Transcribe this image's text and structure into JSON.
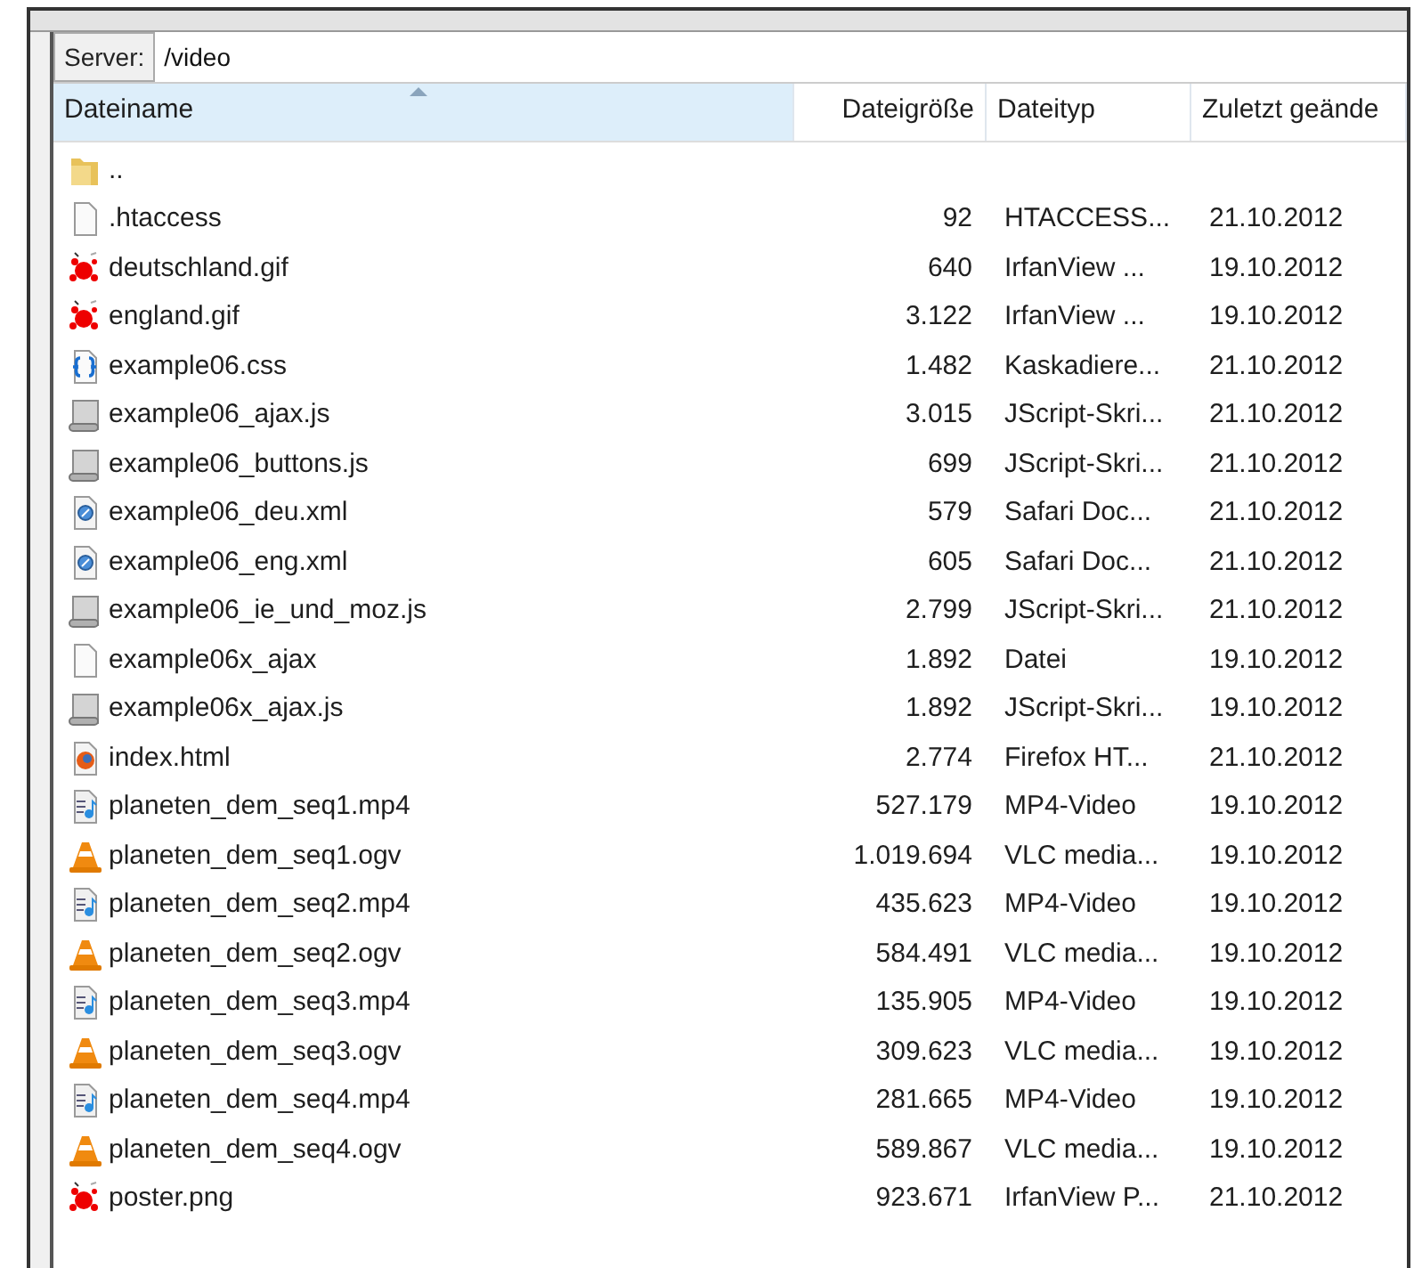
{
  "server": {
    "label": "Server:",
    "value": "/video"
  },
  "columns": [
    {
      "label": "Dateiname",
      "sorted": true
    },
    {
      "label": "Dateigröße",
      "sorted": false
    },
    {
      "label": "Dateityp",
      "sorted": false
    },
    {
      "label": "Zuletzt geände",
      "sorted": false
    }
  ],
  "files": [
    {
      "kind": "folder",
      "name": ".."
    },
    {
      "kind": "blank",
      "name": ".htaccess",
      "size": "92",
      "type": "HTACCESS...",
      "modified": "21.10.2012"
    },
    {
      "kind": "image",
      "name": "deutschland.gif",
      "size": "640",
      "type": "IrfanView ...",
      "modified": "19.10.2012"
    },
    {
      "kind": "image",
      "name": "england.gif",
      "size": "3.122",
      "type": "IrfanView ...",
      "modified": "19.10.2012"
    },
    {
      "kind": "css",
      "name": "example06.css",
      "size": "1.482",
      "type": "Kaskadiere...",
      "modified": "21.10.2012"
    },
    {
      "kind": "script",
      "name": "example06_ajax.js",
      "size": "3.015",
      "type": "JScript-Skri...",
      "modified": "21.10.2012"
    },
    {
      "kind": "script",
      "name": "example06_buttons.js",
      "size": "699",
      "type": "JScript-Skri...",
      "modified": "21.10.2012"
    },
    {
      "kind": "xml",
      "name": "example06_deu.xml",
      "size": "579",
      "type": "Safari Doc...",
      "modified": "21.10.2012"
    },
    {
      "kind": "xml",
      "name": "example06_eng.xml",
      "size": "605",
      "type": "Safari Doc...",
      "modified": "21.10.2012"
    },
    {
      "kind": "script",
      "name": "example06_ie_und_moz.js",
      "size": "2.799",
      "type": "JScript-Skri...",
      "modified": "21.10.2012"
    },
    {
      "kind": "blank",
      "name": "example06x_ajax",
      "size": "1.892",
      "type": "Datei",
      "modified": "19.10.2012"
    },
    {
      "kind": "script",
      "name": "example06x_ajax.js",
      "size": "1.892",
      "type": "JScript-Skri...",
      "modified": "19.10.2012"
    },
    {
      "kind": "html",
      "name": "index.html",
      "size": "2.774",
      "type": "Firefox HT...",
      "modified": "21.10.2012"
    },
    {
      "kind": "mp4",
      "name": "planeten_dem_seq1.mp4",
      "size": "527.179",
      "type": "MP4-Video",
      "modified": "19.10.2012"
    },
    {
      "kind": "ogv",
      "name": "planeten_dem_seq1.ogv",
      "size": "1.019.694",
      "type": "VLC media...",
      "modified": "19.10.2012"
    },
    {
      "kind": "mp4",
      "name": "planeten_dem_seq2.mp4",
      "size": "435.623",
      "type": "MP4-Video",
      "modified": "19.10.2012"
    },
    {
      "kind": "ogv",
      "name": "planeten_dem_seq2.ogv",
      "size": "584.491",
      "type": "VLC media...",
      "modified": "19.10.2012"
    },
    {
      "kind": "mp4",
      "name": "planeten_dem_seq3.mp4",
      "size": "135.905",
      "type": "MP4-Video",
      "modified": "19.10.2012"
    },
    {
      "kind": "ogv",
      "name": "planeten_dem_seq3.ogv",
      "size": "309.623",
      "type": "VLC media...",
      "modified": "19.10.2012"
    },
    {
      "kind": "mp4",
      "name": "planeten_dem_seq4.mp4",
      "size": "281.665",
      "type": "MP4-Video",
      "modified": "19.10.2012"
    },
    {
      "kind": "ogv",
      "name": "planeten_dem_seq4.ogv",
      "size": "589.867",
      "type": "VLC media...",
      "modified": "19.10.2012"
    },
    {
      "kind": "image",
      "name": "poster.png",
      "size": "923.671",
      "type": "IrfanView P...",
      "modified": "21.10.2012"
    }
  ]
}
